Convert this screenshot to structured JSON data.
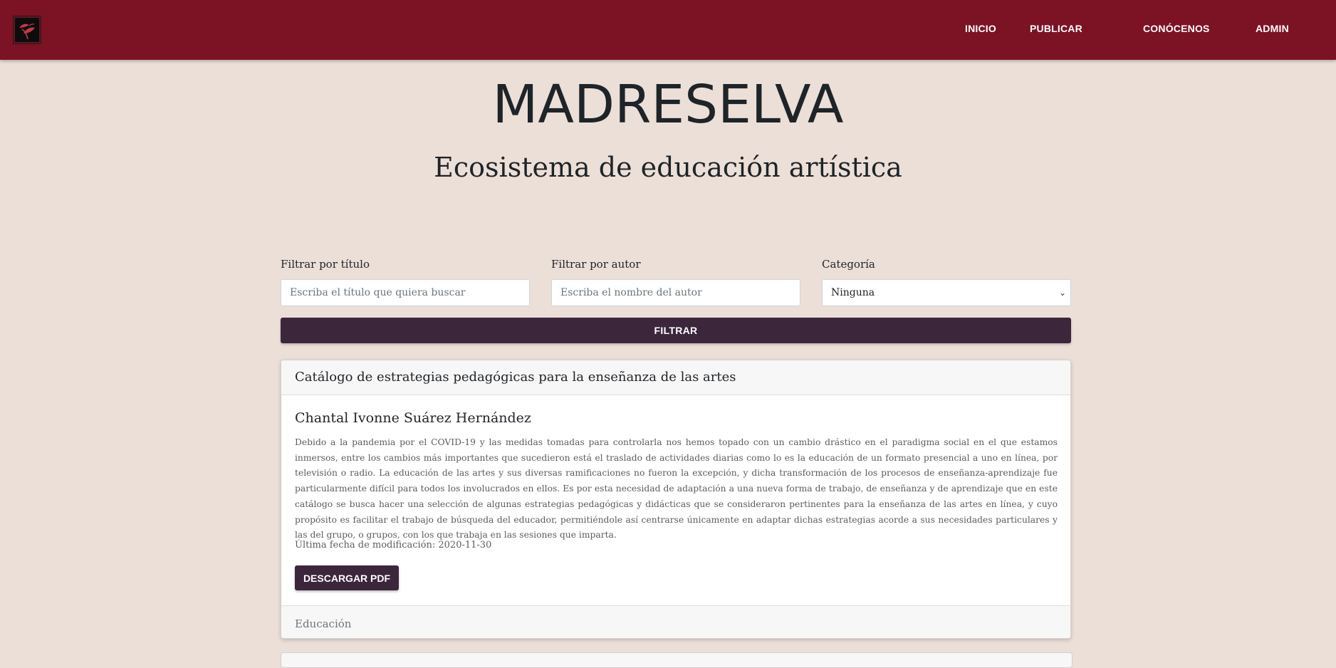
{
  "nav": {
    "logo_icon": "madreselva-leaf-logo-icon",
    "links": [
      "INICIO",
      "PUBLICAR",
      "CONÓCENOS",
      "ADMIN"
    ]
  },
  "hero": {
    "title": "MADRESELVA",
    "subtitle": "Ecosistema de educación artística"
  },
  "filters": {
    "title_label": "Filtrar por título",
    "title_placeholder": "Escriba el título que quiera buscar",
    "author_label": "Filtrar por autor",
    "author_placeholder": "Escriba el nombre del autor",
    "category_label": "Categoría",
    "category_value": "Ninguna",
    "button_label": "FILTRAR"
  },
  "results": [
    {
      "title": "Catálogo de estrategias pedagógicas para la enseñanza de las artes",
      "author": "Chantal Ivonne Suárez Hernández",
      "description": "Debido a la pandemia por el COVID-19 y las medidas tomadas para controlarla nos hemos topado con un cambio drástico en el paradigma social en el que estamos inmersos, entre los cambios más importantes que sucedieron está el traslado de actividades diarias como lo es la educación de un formato presencial a uno en línea, por televisión o radio. La educación de las artes y sus diversas ramificaciones no fueron la excepción, y dicha transformación de los procesos de enseñanza-aprendizaje fue particularmente difícil para todos los involucrados en ellos. Es por esta necesidad de adaptación a una nueva forma de trabajo, de enseñanza y de aprendizaje que en este catálogo se busca hacer una selección de algunas estrategias pedagógicas y didácticas que se consideraron pertinentes para la enseñanza de las artes en línea, y cuyo propósito es facilitar el trabajo de búsqueda del educador, permitiéndole así centrarse únicamente en adaptar dichas estrategias acorde a sus necesidades particulares y las del grupo, o grupos, con los que trabaja en las sesiones que imparta.",
      "modified": "Última fecha de modificación: 2020-11-30",
      "download_label": "DESCARGAR PDF",
      "category": "Educación"
    }
  ],
  "colors": {
    "navbar": "#7b1325",
    "background": "#ecdfd8",
    "button": "#3c263c"
  }
}
